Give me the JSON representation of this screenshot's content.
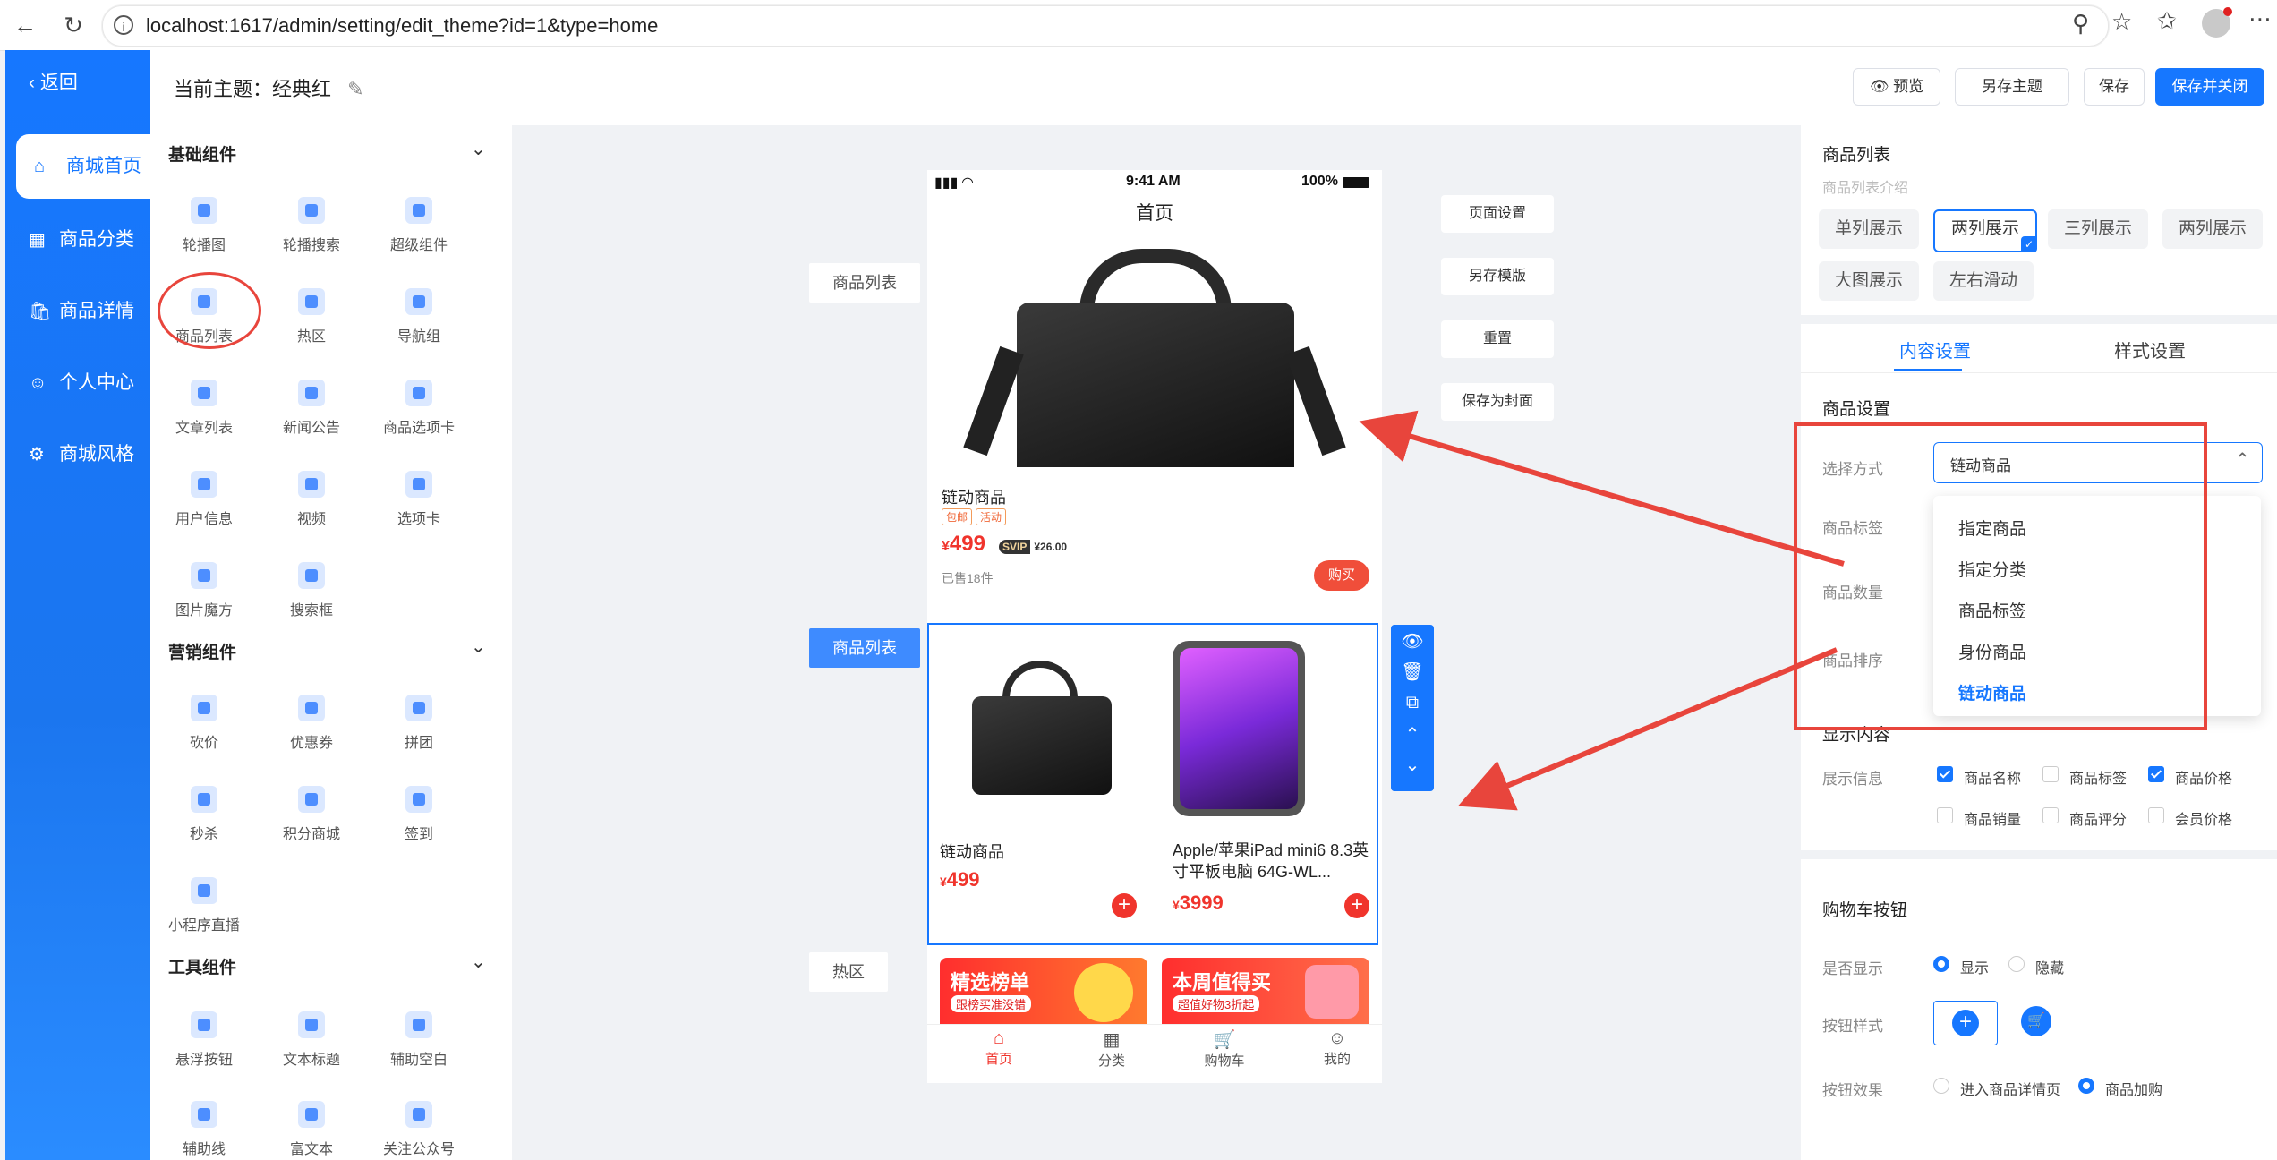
{
  "browser": {
    "url": "localhost:1617/admin/setting/edit_theme?id=1&type=home"
  },
  "nav": {
    "back_label": "返回",
    "items": [
      {
        "label": "商城首页",
        "icon": "home-icon"
      },
      {
        "label": "商品分类",
        "icon": "grid-icon"
      },
      {
        "label": "商品详情",
        "icon": "bag-icon"
      },
      {
        "label": "个人中心",
        "icon": "user-icon"
      },
      {
        "label": "商城风格",
        "icon": "gear-icon"
      }
    ]
  },
  "header": {
    "title": "当前主题：经典红",
    "buttons": {
      "preview": "预览",
      "save_as": "另存主题",
      "save": "保存",
      "save_close": "保存并关闭"
    }
  },
  "components": {
    "basic_title": "基础组件",
    "basic": [
      "轮播图",
      "轮播搜索",
      "超级组件",
      "商品列表",
      "热区",
      "导航组",
      "文章列表",
      "新闻公告",
      "商品选项卡",
      "用户信息",
      "视频",
      "选项卡",
      "图片魔方",
      "搜索框"
    ],
    "marketing_title": "营销组件",
    "marketing": [
      "砍价",
      "优惠券",
      "拼团",
      "秒杀",
      "积分商城",
      "签到",
      "小程序直播"
    ],
    "tools_title": "工具组件",
    "tools": [
      "悬浮按钮",
      "文本标题",
      "辅助空白",
      "辅助线",
      "富文本",
      "关注公众号"
    ]
  },
  "canvas": {
    "labels": {
      "product_list_1": "商品列表",
      "product_list_2": "商品列表",
      "hotspot": "热区"
    },
    "side_buttons": [
      "页面设置",
      "另存模版",
      "重置",
      "保存为封面"
    ],
    "phone": {
      "time": "9:41 AM",
      "battery": "100%",
      "title": "首页",
      "product1": {
        "name": "链动商品",
        "tags": [
          "包邮",
          "活动"
        ],
        "price": "499",
        "svip_label": "SVIP",
        "svip_price": "¥26.00",
        "sold": "已售18件",
        "buy": "购买"
      },
      "grid": [
        {
          "name": "链动商品",
          "price": "499"
        },
        {
          "name": "Apple/苹果iPad mini6 8.3英寸平板电脑 64G-WL...",
          "price": "3999"
        }
      ],
      "banners": [
        {
          "title": "精选榜单",
          "sub": "跟榜买准没错"
        },
        {
          "title": "本周值得买",
          "sub": "超值好物3折起"
        }
      ],
      "tabbar": [
        "首页",
        "分类",
        "购物车",
        "我的"
      ]
    }
  },
  "right": {
    "section_title": "商品列表",
    "section_sub": "商品列表介绍",
    "modes": [
      "单列展示",
      "两列展示",
      "三列展示",
      "两列展示",
      "大图展示",
      "左右滑动"
    ],
    "tabs": [
      "内容设置",
      "样式设置"
    ],
    "goods_settings": "商品设置",
    "select_label": "选择方式",
    "select_value": "链动商品",
    "row_labels": [
      "商品标签",
      "商品数量",
      "商品排序"
    ],
    "dropdown": [
      "指定商品",
      "指定分类",
      "商品标签",
      "身份商品",
      "链动商品"
    ],
    "display_title": "显示内容",
    "display_info_label": "展示信息",
    "checks": [
      {
        "label": "商品名称",
        "on": true
      },
      {
        "label": "商品标签",
        "on": false
      },
      {
        "label": "商品价格",
        "on": true
      },
      {
        "label": "商品销量",
        "on": false
      },
      {
        "label": "商品评分",
        "on": false
      },
      {
        "label": "会员价格",
        "on": false
      }
    ],
    "cart_title": "购物车按钮",
    "show_label": "是否显示",
    "show_opts": [
      "显示",
      "隐藏"
    ],
    "style_label": "按钮样式",
    "effect_label": "按钮效果",
    "effect_opts": [
      "进入商品详情页",
      "商品加购"
    ]
  },
  "colors": {
    "primary": "#1677ff",
    "accent": "#f0342c",
    "annotation": "#e8453c"
  }
}
